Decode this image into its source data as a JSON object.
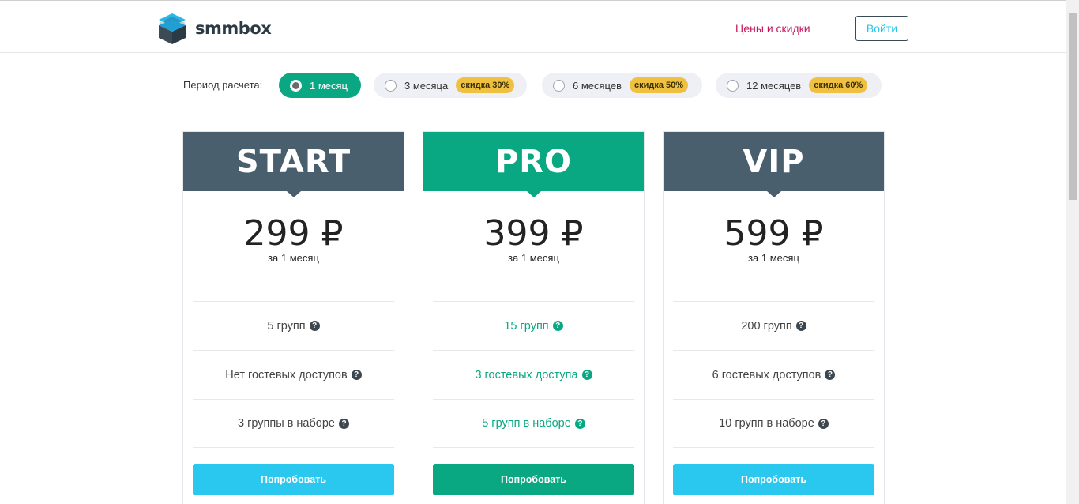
{
  "header": {
    "logo_text": "smmbox",
    "nav_link": "Цены и скидки",
    "login_label": "Войти"
  },
  "period": {
    "label": "Период расчета:",
    "options": [
      {
        "label": "1 месяц",
        "discount": "",
        "selected": true
      },
      {
        "label": "3 месяца",
        "discount": "скидка 30%",
        "selected": false
      },
      {
        "label": "6 месяцев",
        "discount": "скидка 50%",
        "selected": false
      },
      {
        "label": "12 месяцев",
        "discount": "скидка 60%",
        "selected": false
      }
    ]
  },
  "plans": [
    {
      "name": "START",
      "price": "299 ₽",
      "per": "за 1 месяц",
      "features": [
        "5 групп",
        "Нет гостевых доступов",
        "3 группы в наборе"
      ],
      "button": "Попробовать"
    },
    {
      "name": "PRO",
      "price": "399 ₽",
      "per": "за 1 месяц",
      "features": [
        "15 групп",
        "3 гостевых доступа",
        "5 групп в наборе"
      ],
      "button": "Попробовать"
    },
    {
      "name": "VIP",
      "price": "599 ₽",
      "per": "за 1 месяц",
      "features": [
        "200 групп",
        "6 гостевых доступов",
        "10 групп в наборе"
      ],
      "button": "Попробовать"
    }
  ],
  "icons": {
    "help": "?"
  },
  "colors": {
    "primary_green": "#0aa882",
    "header_dark": "#4a5f6e",
    "button_blue": "#2ac8ef",
    "discount_yellow": "#f0c040",
    "nav_link": "#c2185b"
  }
}
